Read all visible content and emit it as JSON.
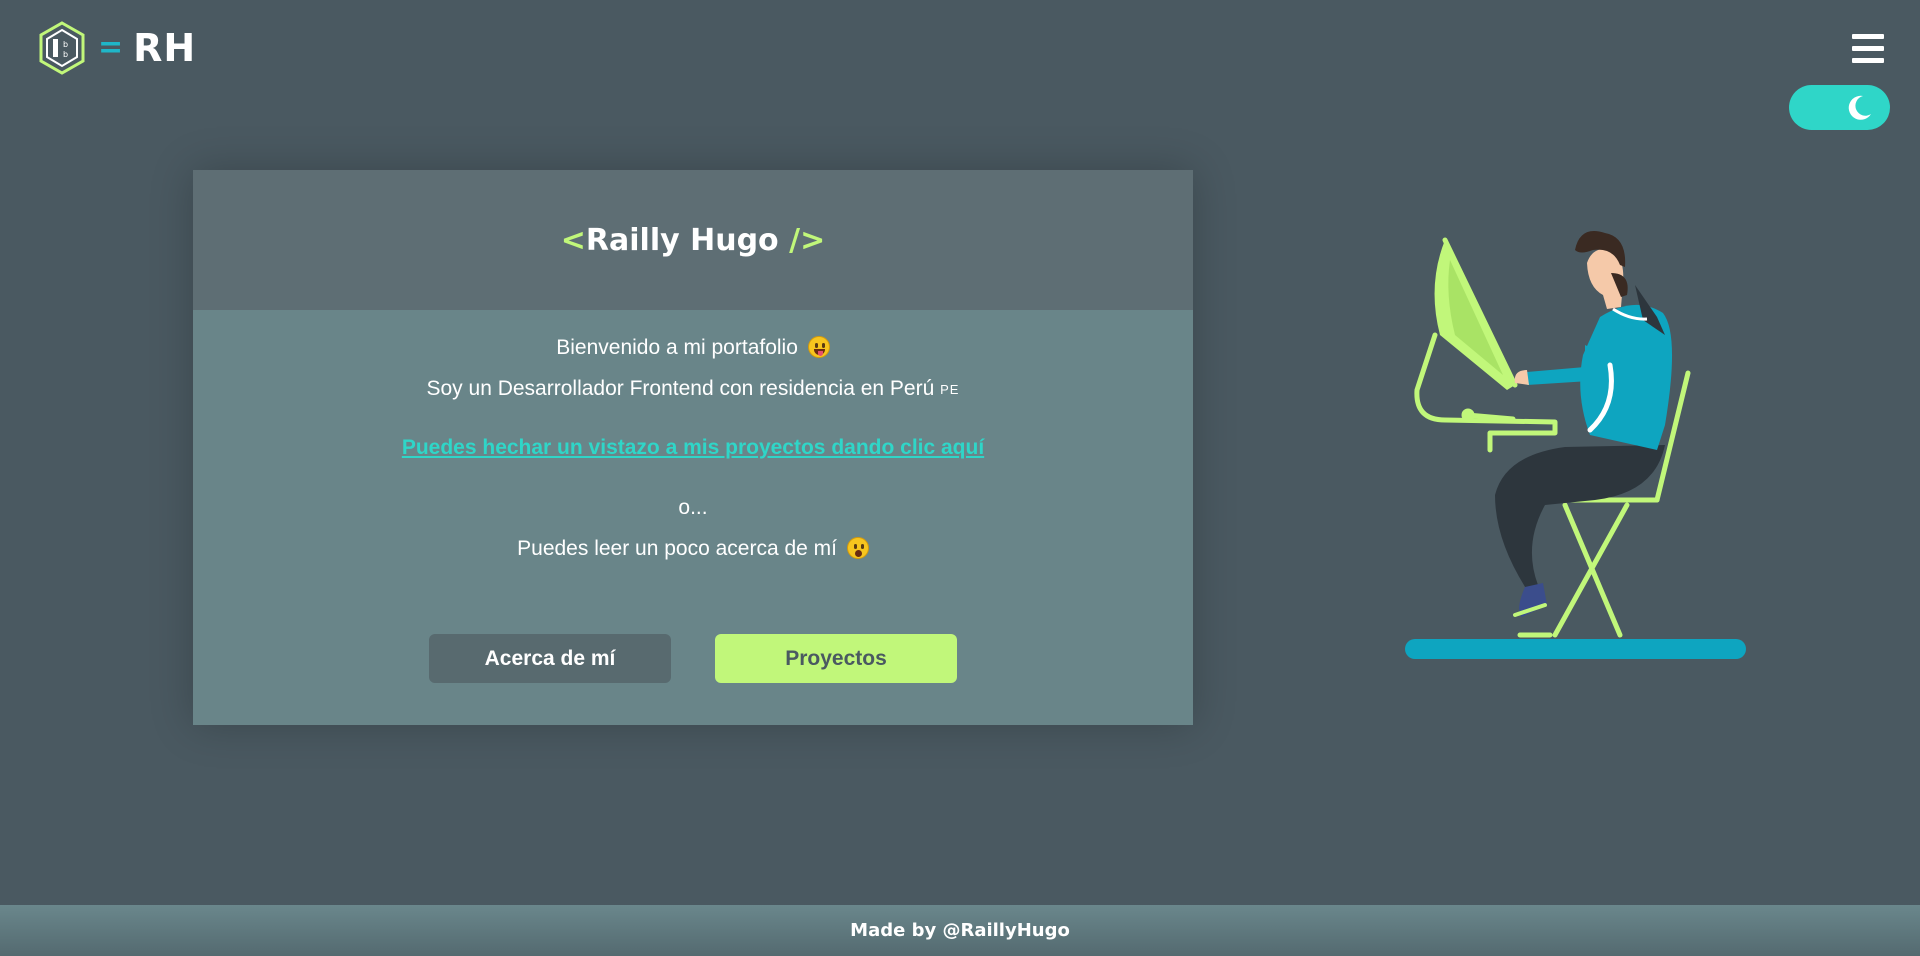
{
  "header": {
    "logo_equals": "=",
    "logo_text": "RH",
    "menu_icon": "hamburger-icon",
    "theme_icon": "moon-icon",
    "accent_color": "#2fd6c8",
    "highlight_color": "#c1f77a"
  },
  "card": {
    "title_open": "<",
    "title_name": "Railly Hugo",
    "title_close": " />",
    "welcome": "Bienvenido a mi portafolio",
    "intro": "Soy un Desarrollador Frontend con residencia en Perú",
    "flag_code": "PE",
    "projects_link": "Puedes hechar un vistazo a mis proyectos dando clic aquí",
    "or": "o...",
    "read_more": "Puedes leer un poco acerca de mí"
  },
  "buttons": {
    "about_label": "Acerca de mí",
    "projects_label": "Proyectos"
  },
  "footer": {
    "text": "Made by @RaillyHugo"
  }
}
